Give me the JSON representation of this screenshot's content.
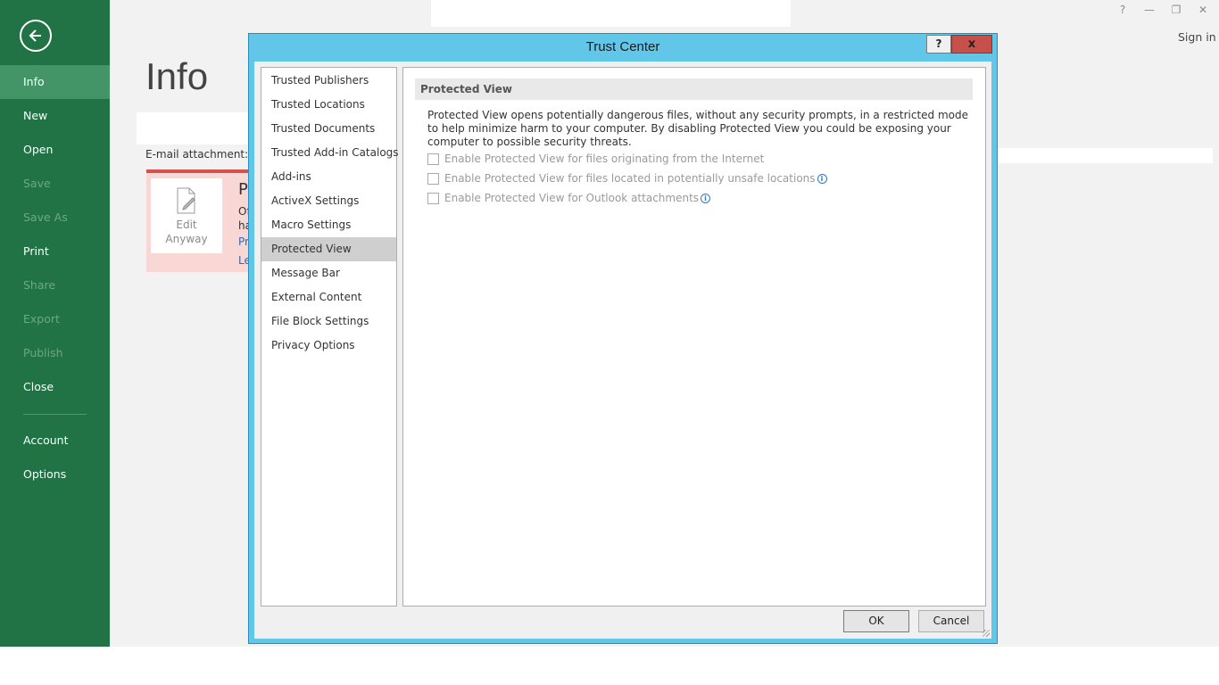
{
  "sidebar": {
    "items": [
      {
        "label": "Info"
      },
      {
        "label": "New"
      },
      {
        "label": "Open"
      },
      {
        "label": "Save"
      },
      {
        "label": "Save As"
      },
      {
        "label": "Print"
      },
      {
        "label": "Share"
      },
      {
        "label": "Export"
      },
      {
        "label": "Publish"
      },
      {
        "label": "Close"
      },
      {
        "label": "Account"
      },
      {
        "label": "Options"
      }
    ]
  },
  "header": {
    "sign_in": "Sign in",
    "controls": {
      "help": "?",
      "minimize": "—",
      "restore": "❐",
      "close": "✕"
    }
  },
  "main": {
    "title": "Info",
    "attachment_label": "E-mail attachment:",
    "edit_anyway": {
      "line1": "Edit",
      "line2": "Anyway"
    },
    "warning_fragments": [
      "P",
      "Of",
      "ha",
      "Pr",
      "Le"
    ]
  },
  "dialog": {
    "title": "Trust Center",
    "help_label": "?",
    "close_label": "x",
    "categories": [
      "Trusted Publishers",
      "Trusted Locations",
      "Trusted Documents",
      "Trusted Add-in Catalogs",
      "Add-ins",
      "ActiveX Settings",
      "Macro Settings",
      "Protected View",
      "Message Bar",
      "External Content",
      "File Block Settings",
      "Privacy Options"
    ],
    "selected_category": "Protected View",
    "section_header": "Protected View",
    "description": "Protected View opens potentially dangerous files, without any security prompts, in a restricted mode to help minimize harm to your computer. By disabling Protected View you could be exposing your computer to possible security threats.",
    "options": [
      {
        "label": "Enable Protected View for files originating from the Internet",
        "checked": false,
        "info": false
      },
      {
        "label": "Enable Protected View for files located in potentially unsafe locations",
        "checked": false,
        "info": true
      },
      {
        "label": "Enable Protected View for Outlook attachments",
        "checked": false,
        "info": true
      }
    ],
    "info_glyph": "i",
    "ok_label": "OK",
    "cancel_label": "Cancel"
  },
  "colors": {
    "sidebar_bg": "#217346",
    "sidebar_active": "#439467",
    "dialog_frame": "#62c6e8",
    "close_button": "#c7504a"
  }
}
